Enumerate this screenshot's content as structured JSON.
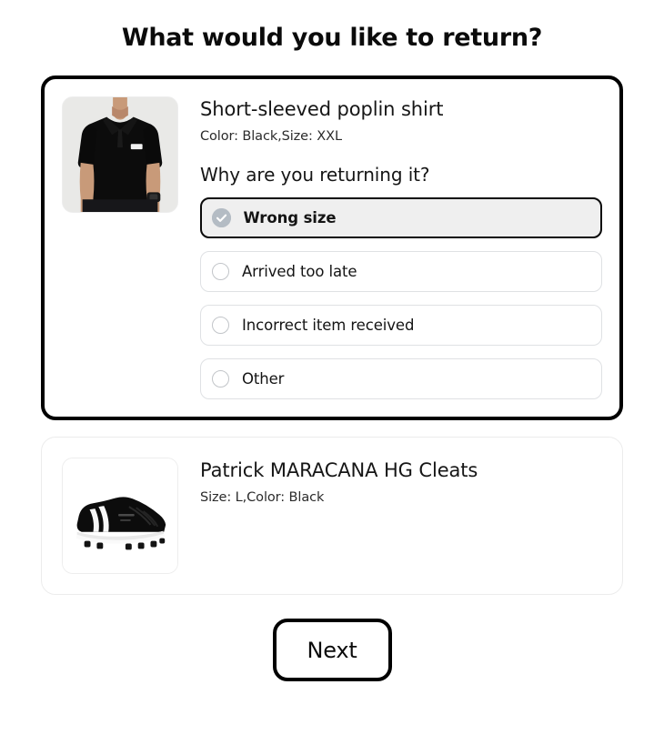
{
  "header": {
    "title": "What would you like to return?"
  },
  "items": [
    {
      "name": "Short-sleeved poplin shirt",
      "meta": "Color: Black,Size: XXL",
      "image_alt": "man-wearing-black-polo-shirt",
      "selected": true,
      "reason_question": "Why are you returning it?",
      "reasons": [
        {
          "label": "Wrong size",
          "checked": true
        },
        {
          "label": "Arrived too late",
          "checked": false
        },
        {
          "label": "Incorrect item received",
          "checked": false
        },
        {
          "label": "Other",
          "checked": false
        }
      ]
    },
    {
      "name": "Patrick MARACANA HG Cleats",
      "meta": "Size: L,Color: Black",
      "image_alt": "black-soccer-cleat-with-white-stripes",
      "selected": false
    }
  ],
  "footer": {
    "next_label": "Next"
  },
  "colors": {
    "page_background": "#ffffff",
    "text_primary": "#121212",
    "selected_border": "#000000",
    "unselected_border": "#ececec",
    "option_border": "#dfe1e4",
    "option_selected_fill": "#efefef",
    "radio_checked_fill": "#b4bcc4",
    "radio_empty_border": "#c2c5c9",
    "shirt_thumb_background": "#e9e9e7"
  },
  "icons": {
    "check_circle": "check-circle-icon",
    "radio_empty": "radio-empty-icon"
  }
}
